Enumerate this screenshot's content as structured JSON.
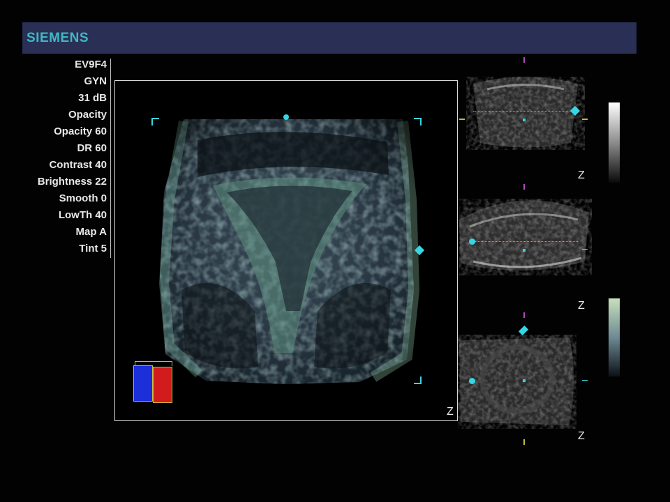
{
  "header": {
    "brand": "SIEMENS"
  },
  "params": [
    "EV9F4",
    "GYN",
    "31 dB",
    "Opacity",
    "Opacity 60",
    "DR 60",
    "Contrast 40",
    "Brightness 22",
    "Smooth 0",
    "LowTh 40",
    "Map A",
    "Tint 5"
  ],
  "views": {
    "main_axis_label": "Z",
    "plane1_axis_label": "Z",
    "plane3_top_axis_label": "Z",
    "plane3_bottom_axis_label": "Z"
  },
  "colors": {
    "header_bg": "#2a2f55",
    "brand": "#3fb9c4",
    "cursor": "#36d6e4",
    "marker_magenta": "#b04ab8",
    "marker_yellow": "#c8b840",
    "orientation_blue": "#1d2fd8",
    "orientation_red": "#d21c1c"
  },
  "icons": {
    "orientation": "orientation-cube-icon",
    "diamond": "diamond-cursor-icon",
    "dot": "center-dot-icon"
  }
}
